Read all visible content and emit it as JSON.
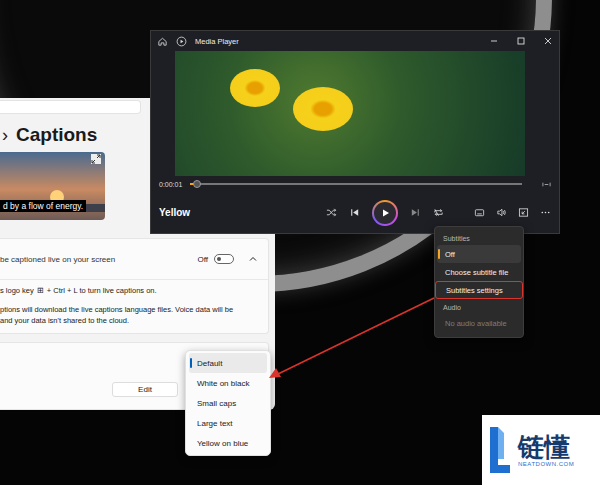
{
  "settings": {
    "breadcrumb_separator": "›",
    "title": "Captions",
    "preview_caption": "d by a flow of energy.",
    "live_captions": {
      "description": "be captioned live on your screen",
      "toggle_label": "Off",
      "on": false,
      "expanded": true,
      "hint_before_key": "s logo key",
      "key": "⊞",
      "hint_after_key": "+ Ctrl + L to turn live captions on.",
      "notice": [
        "ptions will download the live captions language files. Voice data will be",
        "and your data isn't shared to the cloud."
      ]
    },
    "caption_style": {
      "button": "Edit",
      "options": [
        {
          "label": "Default",
          "selected": true
        },
        {
          "label": "White on black",
          "selected": false
        },
        {
          "label": "Small caps",
          "selected": false
        },
        {
          "label": "Large text",
          "selected": false
        },
        {
          "label": "Yellow on blue",
          "selected": false
        }
      ]
    }
  },
  "media_player": {
    "title": "Media Player",
    "time": "0:00:01",
    "position": 0.02,
    "track": "Yellow",
    "playing": false
  },
  "context_menu": {
    "sections": [
      {
        "header": "Subtitles",
        "items": [
          {
            "label": "Off",
            "selected": true,
            "highlighted": false,
            "disabled": false
          },
          {
            "label": "Choose subtitle file",
            "selected": false,
            "highlighted": false,
            "disabled": false
          },
          {
            "label": "Subtitles settings",
            "selected": false,
            "highlighted": true,
            "disabled": false
          }
        ]
      },
      {
        "header": "Audio",
        "items": [
          {
            "label": "No audio available",
            "selected": false,
            "highlighted": false,
            "disabled": true
          }
        ]
      }
    ]
  },
  "watermark": {
    "name": "链懂",
    "site": "NEATDOWN.COM"
  }
}
